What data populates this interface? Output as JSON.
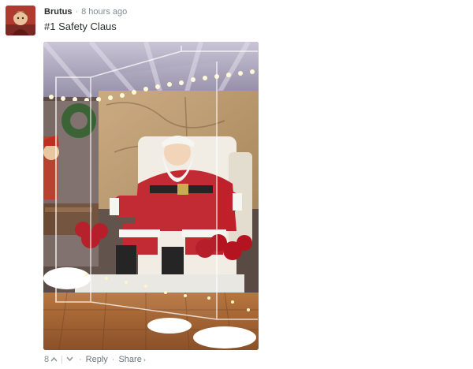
{
  "comment": {
    "author": "Brutus",
    "timestamp": "8 hours ago",
    "message": "#1 Safety Claus",
    "separator_dot": "·"
  },
  "footer": {
    "vote_count": "8",
    "upvote_glyph": "^",
    "downvote_glyph": "v",
    "divider": "|",
    "dot": "·",
    "reply_label": "Reply",
    "share_label": "Share",
    "share_arrow": "›"
  },
  "icons": {
    "upvote": "chevron-up-icon",
    "downvote": "chevron-down-icon",
    "share_arrow": "chevron-right-icon"
  },
  "colors": {
    "author": "#2a2e2e",
    "meta": "#7f8a91",
    "link": "#6a757c"
  }
}
